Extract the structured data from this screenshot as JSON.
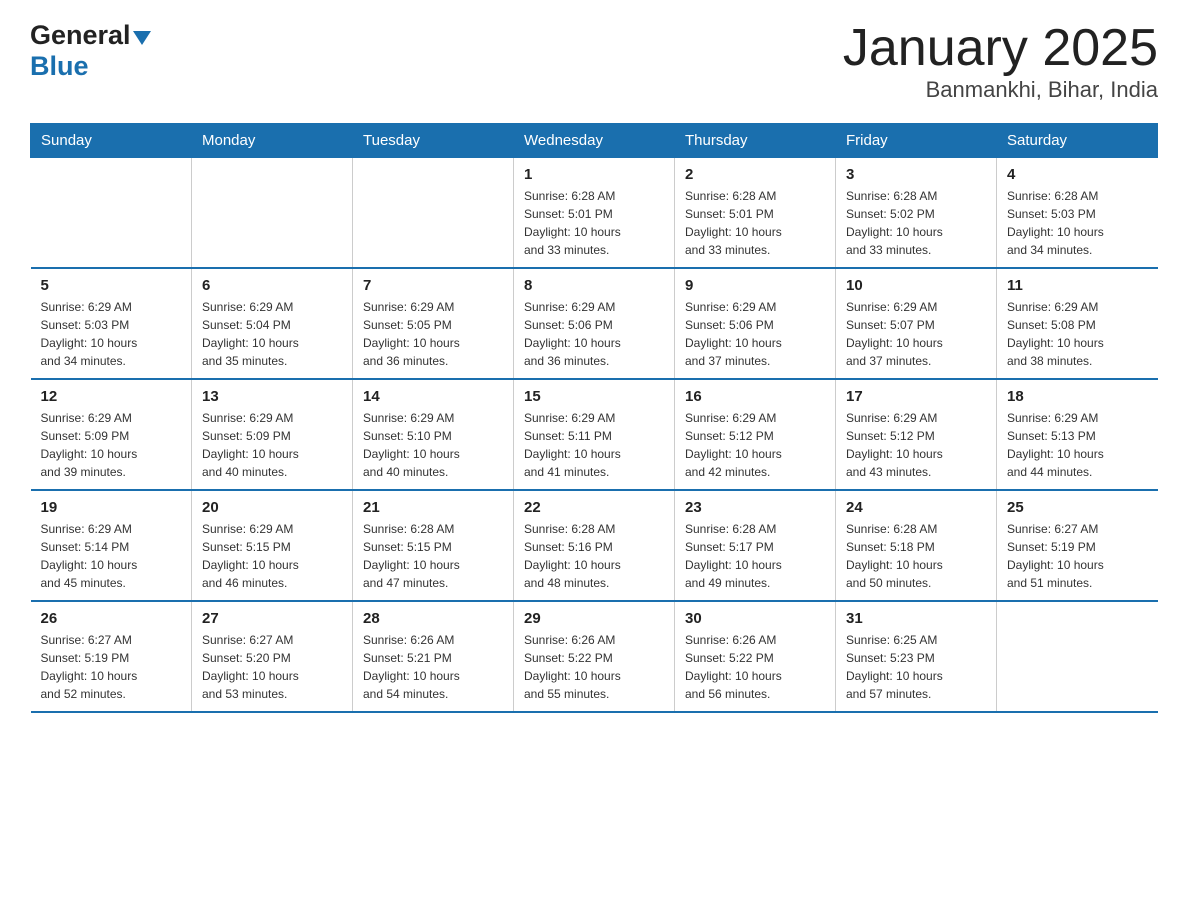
{
  "header": {
    "logo_general": "General",
    "logo_blue": "Blue",
    "month_title": "January 2025",
    "location": "Banmankhi, Bihar, India"
  },
  "weekdays": [
    "Sunday",
    "Monday",
    "Tuesday",
    "Wednesday",
    "Thursday",
    "Friday",
    "Saturday"
  ],
  "weeks": [
    [
      {
        "day": "",
        "info": ""
      },
      {
        "day": "",
        "info": ""
      },
      {
        "day": "",
        "info": ""
      },
      {
        "day": "1",
        "info": "Sunrise: 6:28 AM\nSunset: 5:01 PM\nDaylight: 10 hours\nand 33 minutes."
      },
      {
        "day": "2",
        "info": "Sunrise: 6:28 AM\nSunset: 5:01 PM\nDaylight: 10 hours\nand 33 minutes."
      },
      {
        "day": "3",
        "info": "Sunrise: 6:28 AM\nSunset: 5:02 PM\nDaylight: 10 hours\nand 33 minutes."
      },
      {
        "day": "4",
        "info": "Sunrise: 6:28 AM\nSunset: 5:03 PM\nDaylight: 10 hours\nand 34 minutes."
      }
    ],
    [
      {
        "day": "5",
        "info": "Sunrise: 6:29 AM\nSunset: 5:03 PM\nDaylight: 10 hours\nand 34 minutes."
      },
      {
        "day": "6",
        "info": "Sunrise: 6:29 AM\nSunset: 5:04 PM\nDaylight: 10 hours\nand 35 minutes."
      },
      {
        "day": "7",
        "info": "Sunrise: 6:29 AM\nSunset: 5:05 PM\nDaylight: 10 hours\nand 36 minutes."
      },
      {
        "day": "8",
        "info": "Sunrise: 6:29 AM\nSunset: 5:06 PM\nDaylight: 10 hours\nand 36 minutes."
      },
      {
        "day": "9",
        "info": "Sunrise: 6:29 AM\nSunset: 5:06 PM\nDaylight: 10 hours\nand 37 minutes."
      },
      {
        "day": "10",
        "info": "Sunrise: 6:29 AM\nSunset: 5:07 PM\nDaylight: 10 hours\nand 37 minutes."
      },
      {
        "day": "11",
        "info": "Sunrise: 6:29 AM\nSunset: 5:08 PM\nDaylight: 10 hours\nand 38 minutes."
      }
    ],
    [
      {
        "day": "12",
        "info": "Sunrise: 6:29 AM\nSunset: 5:09 PM\nDaylight: 10 hours\nand 39 minutes."
      },
      {
        "day": "13",
        "info": "Sunrise: 6:29 AM\nSunset: 5:09 PM\nDaylight: 10 hours\nand 40 minutes."
      },
      {
        "day": "14",
        "info": "Sunrise: 6:29 AM\nSunset: 5:10 PM\nDaylight: 10 hours\nand 40 minutes."
      },
      {
        "day": "15",
        "info": "Sunrise: 6:29 AM\nSunset: 5:11 PM\nDaylight: 10 hours\nand 41 minutes."
      },
      {
        "day": "16",
        "info": "Sunrise: 6:29 AM\nSunset: 5:12 PM\nDaylight: 10 hours\nand 42 minutes."
      },
      {
        "day": "17",
        "info": "Sunrise: 6:29 AM\nSunset: 5:12 PM\nDaylight: 10 hours\nand 43 minutes."
      },
      {
        "day": "18",
        "info": "Sunrise: 6:29 AM\nSunset: 5:13 PM\nDaylight: 10 hours\nand 44 minutes."
      }
    ],
    [
      {
        "day": "19",
        "info": "Sunrise: 6:29 AM\nSunset: 5:14 PM\nDaylight: 10 hours\nand 45 minutes."
      },
      {
        "day": "20",
        "info": "Sunrise: 6:29 AM\nSunset: 5:15 PM\nDaylight: 10 hours\nand 46 minutes."
      },
      {
        "day": "21",
        "info": "Sunrise: 6:28 AM\nSunset: 5:15 PM\nDaylight: 10 hours\nand 47 minutes."
      },
      {
        "day": "22",
        "info": "Sunrise: 6:28 AM\nSunset: 5:16 PM\nDaylight: 10 hours\nand 48 minutes."
      },
      {
        "day": "23",
        "info": "Sunrise: 6:28 AM\nSunset: 5:17 PM\nDaylight: 10 hours\nand 49 minutes."
      },
      {
        "day": "24",
        "info": "Sunrise: 6:28 AM\nSunset: 5:18 PM\nDaylight: 10 hours\nand 50 minutes."
      },
      {
        "day": "25",
        "info": "Sunrise: 6:27 AM\nSunset: 5:19 PM\nDaylight: 10 hours\nand 51 minutes."
      }
    ],
    [
      {
        "day": "26",
        "info": "Sunrise: 6:27 AM\nSunset: 5:19 PM\nDaylight: 10 hours\nand 52 minutes."
      },
      {
        "day": "27",
        "info": "Sunrise: 6:27 AM\nSunset: 5:20 PM\nDaylight: 10 hours\nand 53 minutes."
      },
      {
        "day": "28",
        "info": "Sunrise: 6:26 AM\nSunset: 5:21 PM\nDaylight: 10 hours\nand 54 minutes."
      },
      {
        "day": "29",
        "info": "Sunrise: 6:26 AM\nSunset: 5:22 PM\nDaylight: 10 hours\nand 55 minutes."
      },
      {
        "day": "30",
        "info": "Sunrise: 6:26 AM\nSunset: 5:22 PM\nDaylight: 10 hours\nand 56 minutes."
      },
      {
        "day": "31",
        "info": "Sunrise: 6:25 AM\nSunset: 5:23 PM\nDaylight: 10 hours\nand 57 minutes."
      },
      {
        "day": "",
        "info": ""
      }
    ]
  ]
}
